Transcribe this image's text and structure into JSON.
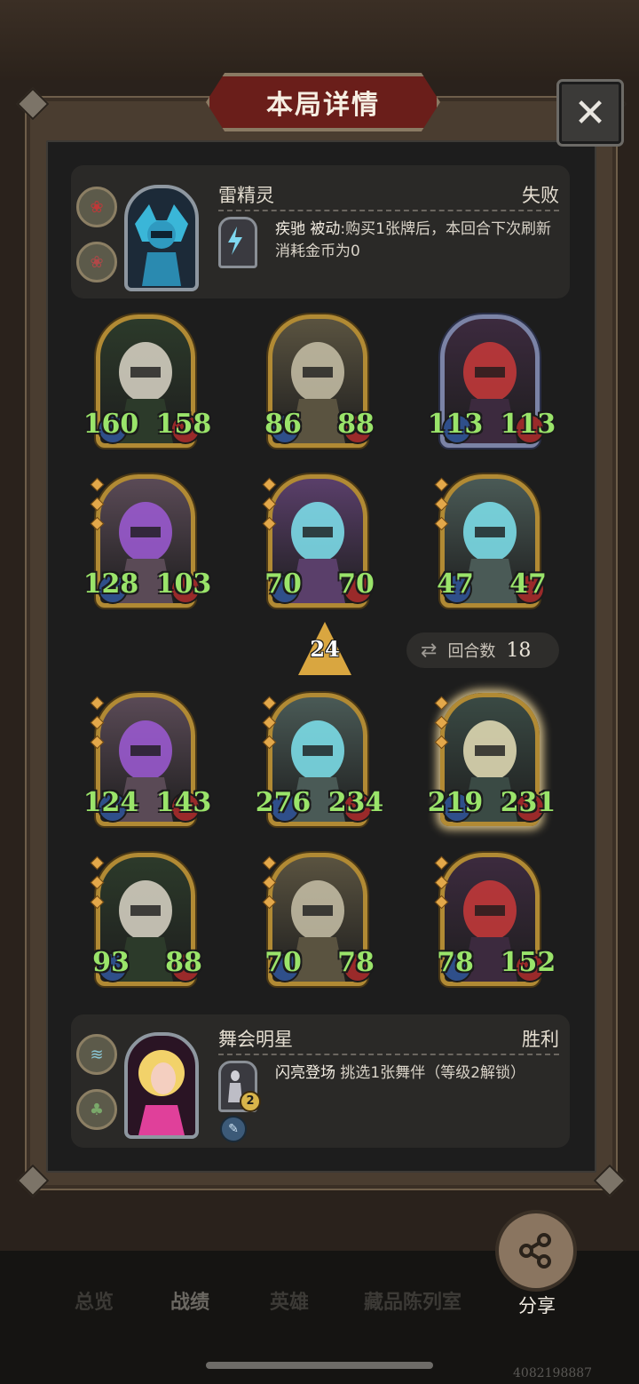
{
  "title": "本局详情",
  "close_label": "✕",
  "top_hero": {
    "name": "雷精灵",
    "result": "失败",
    "skill_name": "疾驰",
    "skill_type": "被动",
    "skill_desc": ":购买1张牌后，本回合下次刷新消耗金币为0"
  },
  "top_board": [
    {
      "attack": "160",
      "health": "158"
    },
    {
      "attack": "86",
      "health": "88"
    },
    {
      "attack": "113",
      "health": "113"
    },
    {
      "attack": "128",
      "health": "103"
    },
    {
      "attack": "70",
      "health": "70"
    },
    {
      "attack": "47",
      "health": "47"
    }
  ],
  "tier": "24",
  "round": {
    "label": "回合数",
    "value": "18"
  },
  "bottom_board": [
    {
      "attack": "124",
      "health": "143"
    },
    {
      "attack": "276",
      "health": "234"
    },
    {
      "attack": "219",
      "health": "231"
    },
    {
      "attack": "93",
      "health": "88"
    },
    {
      "attack": "70",
      "health": "78"
    },
    {
      "attack": "78",
      "health": "152"
    }
  ],
  "bottom_hero": {
    "name": "舞会明星",
    "result": "胜利",
    "skill_name": "闪亮登场",
    "skill_desc": "挑选1张舞伴（等级2解锁）",
    "skill_level": "2"
  },
  "tabs": [
    "总览",
    "战绩",
    "英雄",
    "藏品陈列室"
  ],
  "share_label": "分享",
  "watermark": "4082198887"
}
